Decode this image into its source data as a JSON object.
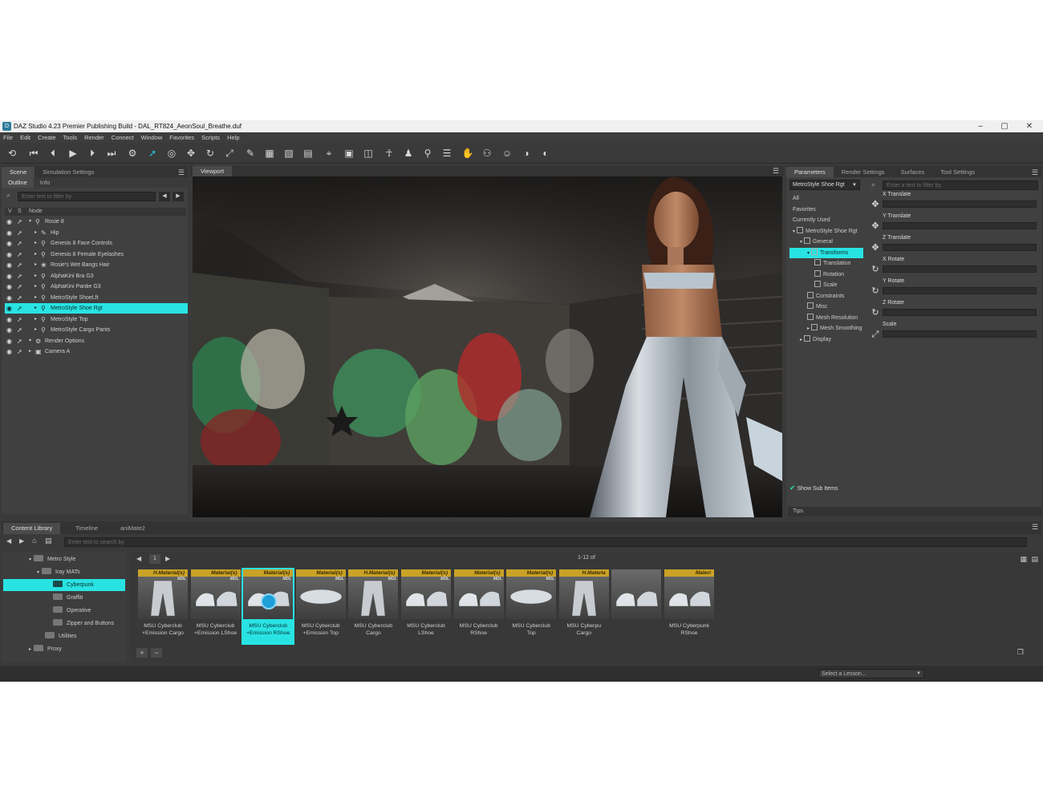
{
  "window": {
    "title": "DAZ Studio 4.23 Premier Publishing Build - DAL_RT824_AeonSoul_Breathe.duf",
    "controls": [
      "–",
      "▢",
      "✕"
    ]
  },
  "menu": [
    "File",
    "Edit",
    "Create",
    "Tools",
    "Render",
    "Connect",
    "Window",
    "Favorites",
    "Scripts",
    "Help"
  ],
  "scene_panel": {
    "tabs": [
      "Scene",
      "Simulation Settings"
    ],
    "subtabs": [
      "Outline",
      "Info"
    ],
    "filter_placeholder": "Enter text to filter by",
    "header": {
      "v": "V",
      "s": "S",
      "node": "Node"
    },
    "nodes": [
      {
        "label": "Rosie 8",
        "depth": 0,
        "icon": "figure-icon",
        "selected": false
      },
      {
        "label": "Hip",
        "depth": 1,
        "icon": "bone-icon",
        "selected": false
      },
      {
        "label": "Genesis 8 Face Controls",
        "depth": 1,
        "icon": "figure-icon",
        "selected": false
      },
      {
        "label": "Genesis 8 Female Eyelashes",
        "depth": 1,
        "icon": "figure-icon",
        "selected": false
      },
      {
        "label": "Rosie's Wet Bangs Hair",
        "depth": 1,
        "icon": "hair-icon",
        "selected": false
      },
      {
        "label": "AlphaKini Bra G3",
        "depth": 1,
        "icon": "figure-icon",
        "selected": false
      },
      {
        "label": "AlphaKini Pantie G3",
        "depth": 1,
        "icon": "figure-icon",
        "selected": false
      },
      {
        "label": "MetroStyle ShoeLft",
        "depth": 1,
        "icon": "figure-icon",
        "selected": false
      },
      {
        "label": "MetroStyle Shoe Rgt",
        "depth": 1,
        "icon": "figure-icon",
        "selected": true
      },
      {
        "label": "MetroStyle Top",
        "depth": 1,
        "icon": "figure-icon",
        "selected": false
      },
      {
        "label": "MetroStyle Cargo Pants",
        "depth": 1,
        "icon": "figure-icon",
        "selected": false
      },
      {
        "label": "Render Options",
        "depth": 0,
        "icon": "render-icon",
        "selected": false
      },
      {
        "label": "Camera A",
        "depth": 0,
        "icon": "camera-icon",
        "selected": false
      }
    ]
  },
  "viewport": {
    "tab": "Viewport"
  },
  "param_panel": {
    "tabs": [
      "Parameters",
      "Render Settings",
      "Surfaces",
      "Tool Settings"
    ],
    "node_select": "MetroStyle Shoe Rgt",
    "filter_placeholder": "Enter a text to filter by",
    "categories": [
      {
        "label": "All",
        "indent": 0,
        "selected": false
      },
      {
        "label": "Favorites",
        "indent": 0,
        "selected": false
      },
      {
        "label": "Currently Used",
        "indent": 0,
        "selected": false
      },
      {
        "label": "MetroStyle Shoe Rgt",
        "indent": 0,
        "selected": false
      },
      {
        "label": "General",
        "indent": 1,
        "selected": false
      },
      {
        "label": "Transforms",
        "indent": 2,
        "selected": true
      },
      {
        "label": "Translation",
        "indent": 3,
        "selected": false
      },
      {
        "label": "Rotation",
        "indent": 3,
        "selected": false
      },
      {
        "label": "Scale",
        "indent": 3,
        "selected": false
      },
      {
        "label": "Constraints",
        "indent": 2,
        "selected": false
      },
      {
        "label": "Misc",
        "indent": 2,
        "selected": false
      },
      {
        "label": "Mesh Resolution",
        "indent": 2,
        "selected": false
      },
      {
        "label": "Mesh Smoothing",
        "indent": 2,
        "selected": false
      },
      {
        "label": "Display",
        "indent": 1,
        "selected": false
      }
    ],
    "properties": [
      "X Translate",
      "Y Translate",
      "Z Translate",
      "X Rotate",
      "Y Rotate",
      "Z Rotate",
      "Scale"
    ],
    "show_sub_items": "Show Sub Items",
    "tips": "Tips"
  },
  "content_library": {
    "tabs": [
      "Content Library",
      "Timeline",
      "aniMate2"
    ],
    "search_placeholder": "Enter text to search by",
    "page": "1",
    "range": "1-12 of",
    "tree": [
      {
        "label": "Metro Style",
        "indent": 0,
        "arrow": "▾",
        "selected": false
      },
      {
        "label": "Iray MATs",
        "indent": 1,
        "arrow": "▾",
        "selected": false
      },
      {
        "label": "Cyberpunk",
        "indent": 2,
        "arrow": "",
        "selected": true
      },
      {
        "label": "Graffiti",
        "indent": 2,
        "arrow": "",
        "selected": false
      },
      {
        "label": "Operative",
        "indent": 2,
        "arrow": "",
        "selected": false
      },
      {
        "label": "Zipper and Buttons",
        "indent": 2,
        "arrow": "",
        "selected": false
      },
      {
        "label": "Utilities",
        "indent": 1,
        "arrow": "",
        "selected": false
      },
      {
        "label": "Proxy",
        "indent": 0,
        "arrow": "▸",
        "selected": false
      }
    ],
    "items": [
      {
        "badge": "H.Material(s)",
        "tag": "MDL",
        "line1": "MSU Cyberclub",
        "line2": "+Emission Cargo",
        "kind": "pants",
        "selected": false
      },
      {
        "badge": "Material(s)",
        "tag": "MDL",
        "line1": "MSU Cyberclub",
        "line2": "+Emission LShoe",
        "kind": "shoes",
        "selected": false
      },
      {
        "badge": "Material(s)",
        "tag": "MDL",
        "line1": "MSU Cyberclub",
        "line2": "+Emission RShoe",
        "kind": "shoes",
        "selected": true
      },
      {
        "badge": "Material(s)",
        "tag": "MDL",
        "line1": "MSU Cyberclub",
        "line2": "+Emission Top",
        "kind": "top",
        "selected": false
      },
      {
        "badge": "H.Material(s)",
        "tag": "MDL",
        "line1": "MSU Cyberclub",
        "line2": "Cargo",
        "kind": "pants",
        "selected": false
      },
      {
        "badge": "Material(s)",
        "tag": "MDL",
        "line1": "MSU Cyberclub",
        "line2": "LShoe",
        "kind": "shoes",
        "selected": false
      },
      {
        "badge": "Material(s)",
        "tag": "MDL",
        "line1": "MSU Cyberclub",
        "line2": "RShoe",
        "kind": "shoes",
        "selected": false
      },
      {
        "badge": "Material(s)",
        "tag": "MDL",
        "line1": "MSU Cyberclub",
        "line2": "Top",
        "kind": "top",
        "selected": false
      },
      {
        "badge": "H.Materia",
        "tag": "",
        "line1": "MSU Cyberpu",
        "line2": "Cargo",
        "kind": "pants",
        "selected": false
      },
      {
        "badge": "",
        "tag": "",
        "line1": "",
        "line2": "",
        "kind": "shoes",
        "selected": false
      },
      {
        "badge": "Materi",
        "tag": "",
        "line1": "MSU Cyberpunk",
        "line2": "RShoe",
        "kind": "shoes",
        "selected": false
      }
    ]
  },
  "status": {
    "lesson_select": "Select a Lesson..."
  },
  "colors": {
    "selection": "#29e3e3",
    "badge": "#c9a227",
    "panel": "#404040"
  }
}
